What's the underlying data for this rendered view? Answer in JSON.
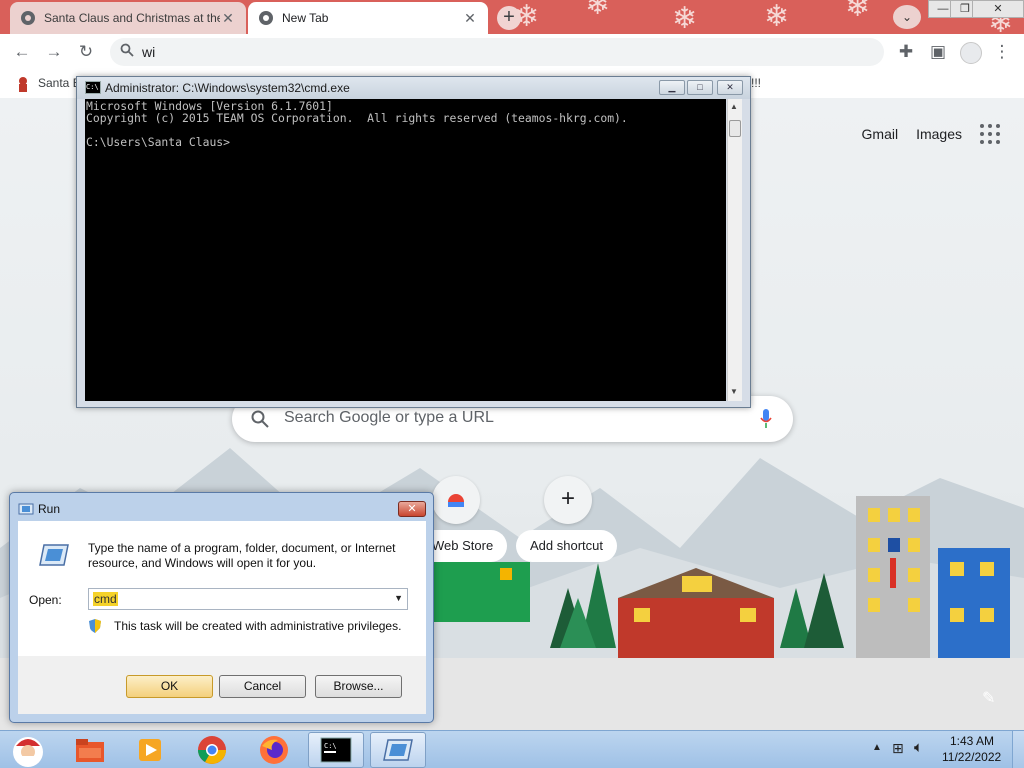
{
  "browser": {
    "tabs": [
      {
        "title": "Santa Claus and Christmas at the"
      },
      {
        "title": "New Tab"
      }
    ],
    "omnibox": {
      "value": "wi"
    },
    "bookmarks": [
      {
        "label": "Santa B"
      }
    ],
    "bookmarks_overflow": "!!!",
    "colors": {
      "tabstrip": "#d9605a",
      "accent": "#1a73e8"
    }
  },
  "ntp": {
    "links": {
      "gmail": "Gmail",
      "images": "Images"
    },
    "search_placeholder": "Search Google or type a URL",
    "shortcuts": [
      {
        "label": "Web Store"
      },
      {
        "label": "Add shortcut"
      }
    ]
  },
  "cmd": {
    "title": "Administrator: C:\\Windows\\system32\\cmd.exe",
    "icon_text": "C:\\",
    "lines": [
      "Microsoft Windows [Version 6.1.7601]",
      "Copyright (c) 2015 TEAM OS Corporation.  All rights reserved (teamos-hkrg.com).",
      "",
      "C:\\Users\\Santa Claus>"
    ]
  },
  "run": {
    "title": "Run",
    "description": "Type the name of a program, folder, document, or Internet resource, and Windows will open it for you.",
    "open_label": "Open:",
    "open_value": "cmd",
    "admin_note": "This task will be created with administrative privileges.",
    "buttons": {
      "ok": "OK",
      "cancel": "Cancel",
      "browse": "Browse..."
    }
  },
  "taskbar": {
    "clock_time": "1:43 AM",
    "clock_date": "11/22/2022",
    "items": [
      "start-orb",
      "file-explorer",
      "media-player",
      "chrome",
      "firefox",
      "cmd",
      "run"
    ]
  }
}
